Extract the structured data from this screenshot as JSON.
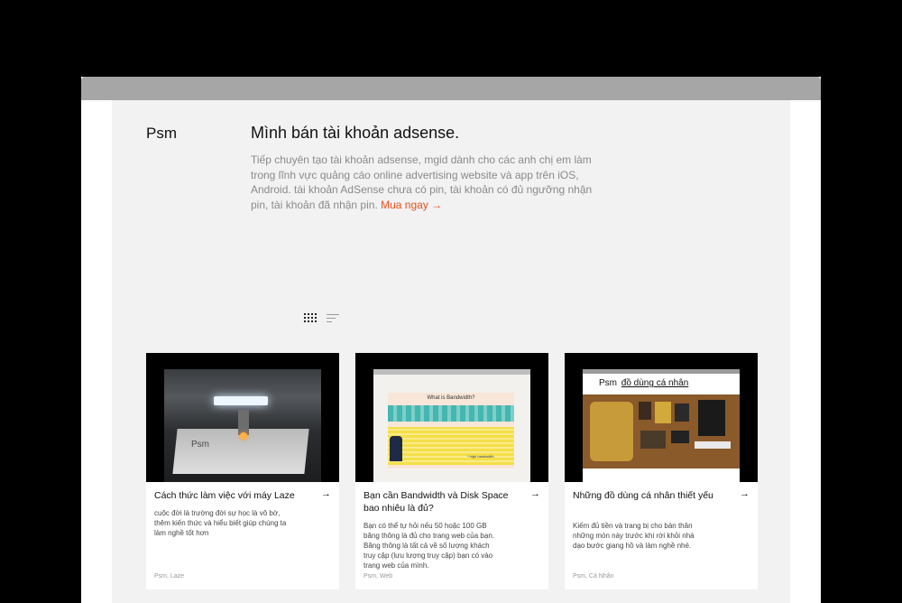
{
  "site": {
    "brand": "Psm"
  },
  "intro": {
    "heading": "Mình bán tài khoản adsense.",
    "body": "Tiếp chuyên tạo tài khoản adsense, mgid dành cho các anh chị em làm trong lĩnh vực quảng cáo online advertising website và app trên iOS, Android. tài khoản AdSense chưa có pin, tài khoản có đủ ngưỡng nhận pin, tài khoản đã nhận pin.",
    "cta": "Mua ngay →"
  },
  "view_toggle": {
    "grid_icon": "grid-icon",
    "list_icon": "list-icon"
  },
  "cards": [
    {
      "title": "Cách thức làm việc với máy Laze",
      "desc": "cuộc đời là trường đời sự học là vô bờ, thêm kiến thức và hiểu biết giúp chúng ta làm nghề tốt hơn",
      "tags": "Psm, Laze",
      "arrow": "→",
      "thumb_text": "Psm"
    },
    {
      "title": "Bạn cần Bandwidth và Disk Space bao nhiêu là đủ?",
      "desc": "Bạn có thể tự hỏi nếu 50 hoặc 100 GB băng thông là đủ cho trang web của bạn. Băng thông là tất cả về số lượng khách truy cập (lưu lượng truy cập) bạn có vào trang web của mình.",
      "tags": "Psm, Web",
      "arrow": "→",
      "thumb_text": "What is Bandwidth?",
      "thumb_label": "* high bandwidth"
    },
    {
      "title": "Những đồ dùng cá nhân thiết yếu",
      "desc": "Kiếm đủ tiền và trang bị cho bản thân những món này trước khi rời khỏi nhà dạo bước giang hồ và làm nghề nhé.",
      "tags": "Psm, Cá Nhân",
      "arrow": "→",
      "thumb_brand": "Psm",
      "thumb_text": "đồ dùng cá nhân"
    }
  ],
  "colors": {
    "accent": "#e8501c",
    "page_bg": "#f2f2f2",
    "frame": "#000000"
  }
}
